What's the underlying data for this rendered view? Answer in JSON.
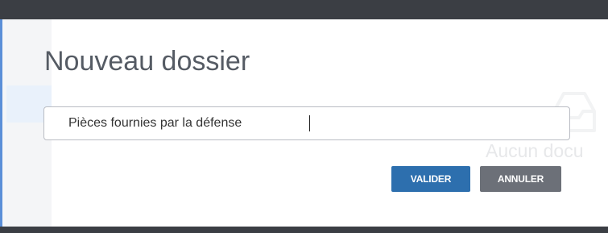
{
  "dialog": {
    "title": "Nouveau dossier",
    "folder_name_value": "Pièces fournies par la défense",
    "validate_label": "VALIDER",
    "cancel_label": "ANNULER"
  },
  "background": {
    "empty_state_text": "Aucun docu",
    "empty_state_icon": "inbox-icon"
  },
  "colors": {
    "validate_button": "#2d6fae",
    "cancel_button": "#6c7078",
    "title_text": "#555b64",
    "top_bar": "#3b3e44"
  }
}
